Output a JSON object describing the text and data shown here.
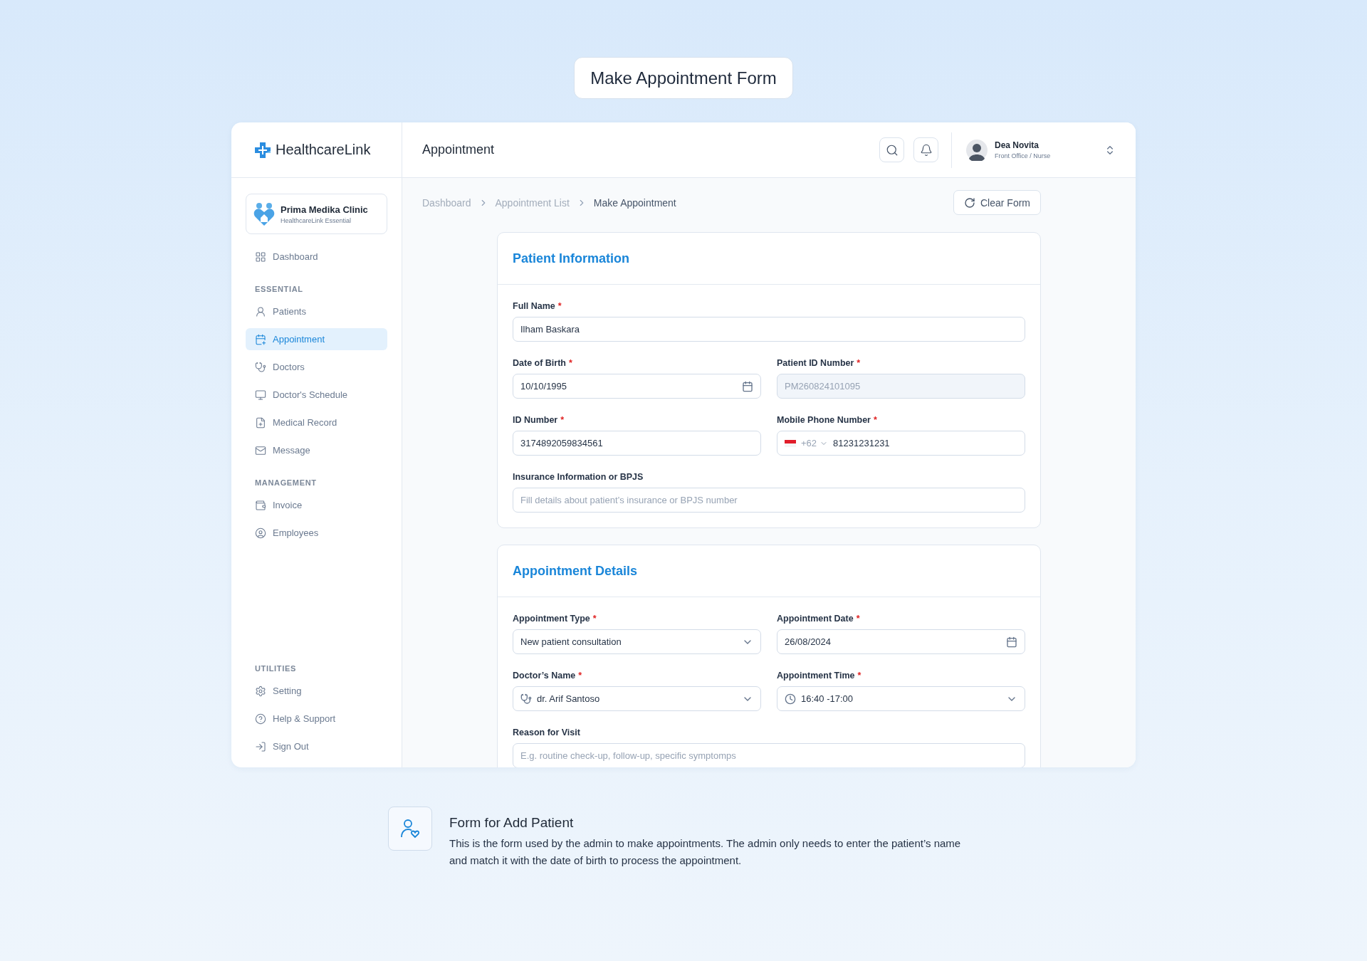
{
  "page_title": "Make Appointment Form",
  "app": {
    "logo": "HealthcareLink",
    "header": {
      "title": "Appointment",
      "user": {
        "name": "Dea Novita",
        "role": "Front Office / Nurse"
      }
    },
    "clinic": {
      "name": "Prima Medika Clinic",
      "plan": "HealthcareLink Essential"
    },
    "sidebar": {
      "sections": [
        {
          "items": [
            {
              "label": "Dashboard",
              "kind": "dashboard",
              "selected": false
            }
          ]
        },
        {
          "heading": "ESSENTIAL",
          "items": [
            {
              "label": "Patients",
              "kind": "patients",
              "selected": false
            },
            {
              "label": "Appointment",
              "kind": "appointment",
              "selected": true
            },
            {
              "label": "Doctors",
              "kind": "doctors",
              "selected": false
            },
            {
              "label": "Doctor's Schedule",
              "kind": "schedule",
              "selected": false
            },
            {
              "label": "Medical Record",
              "kind": "record",
              "selected": false
            },
            {
              "label": "Message",
              "kind": "message",
              "selected": false
            }
          ]
        },
        {
          "heading": "MANAGEMENT",
          "items": [
            {
              "label": "Invoice",
              "kind": "invoice",
              "selected": false
            },
            {
              "label": "Employees",
              "kind": "employees",
              "selected": false
            }
          ]
        },
        {
          "heading": "UTILITIES",
          "items": [
            {
              "label": "Setting",
              "kind": "setting",
              "selected": false
            },
            {
              "label": "Help & Support",
              "kind": "help",
              "selected": false
            },
            {
              "label": "Sign Out",
              "kind": "signout",
              "selected": false
            }
          ]
        }
      ]
    },
    "breadcrumb": [
      {
        "label": "Dashboard",
        "current": false
      },
      {
        "label": "Appointment List",
        "current": false
      },
      {
        "label": "Make Appointment",
        "current": true
      }
    ],
    "clear_button": "Clear Form",
    "sections": [
      {
        "title": "Patient Information",
        "rows": [
          [
            {
              "label": "Full Name",
              "mark": "*",
              "kind": "text",
              "value": "Ilham Baskara",
              "disabled": false
            }
          ],
          [
            {
              "label": "Date of Birth",
              "mark": "*",
              "kind": "date",
              "value": "10/10/1995",
              "disabled": false
            },
            {
              "label": "Patient ID Number",
              "mark": "*",
              "kind": "text",
              "value": "PM260824101095",
              "disabled": true
            }
          ],
          [
            {
              "label": "ID Number",
              "mark": "*",
              "kind": "text",
              "value": "3174892059834561",
              "disabled": false
            },
            {
              "label": "Mobile Phone Number",
              "mark": "*",
              "kind": "phone",
              "code": "+62",
              "value": "81231231231",
              "disabled": false
            }
          ],
          [
            {
              "label": "Insurance Information or BPJS",
              "kind": "text",
              "placeholder": "Fill details about patient’s insurance or BPJS number",
              "disabled": false
            }
          ]
        ]
      },
      {
        "title": "Appointment Details",
        "rows": [
          [
            {
              "label": "Appointment Type",
              "mark": "*",
              "kind": "select",
              "value": "New patient consultation",
              "disabled": false
            },
            {
              "label": "Appointment Date",
              "mark": "*",
              "kind": "date",
              "value": "26/08/2024",
              "disabled": false
            }
          ],
          [
            {
              "label": "Doctor’s Name",
              "mark": "*",
              "kind": "doctor",
              "value": "dr. Arif Santoso",
              "disabled": false
            },
            {
              "label": "Appointment Time",
              "mark": "*",
              "kind": "time",
              "value": "16:40 -17:00",
              "disabled": false
            }
          ],
          [
            {
              "label": "Reason for Visit",
              "kind": "text",
              "placeholder": "E.g. routine check-up, follow-up, specific symptomps",
              "disabled": false
            }
          ]
        ]
      }
    ]
  },
  "footer": {
    "title": "Form for Add Patient",
    "text": "This is the form used by the admin to make appointments. The admin only needs to enter the patient’s name and match it with the date of birth to process the appointment."
  }
}
